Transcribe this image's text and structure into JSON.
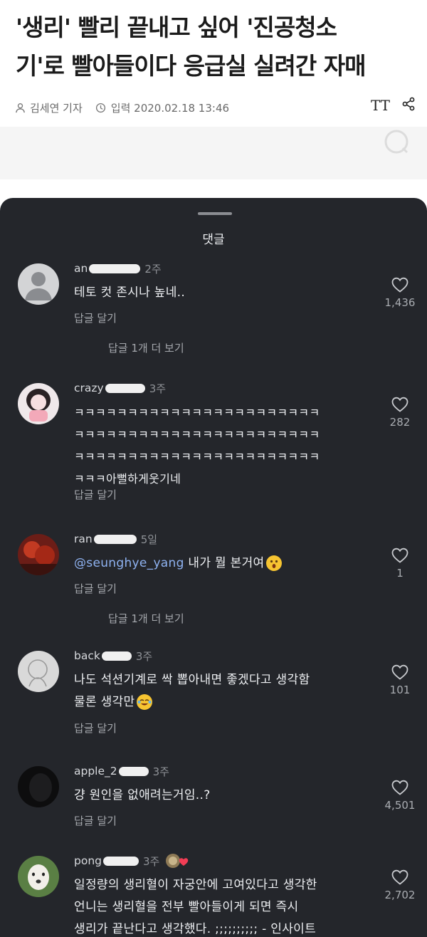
{
  "article": {
    "headline_line1": "'생리' 빨리 끝내고 싶어 '진공청소",
    "headline_line2": "기'로 빨아들이다 응급실 실려간 자매",
    "reporter": "김세연 기자",
    "date_label": "입력 2020.02.18 13:46",
    "font_tool_label": "TT",
    "icons": [
      "person-icon",
      "clock-icon",
      "font-size-icon",
      "share-icon"
    ]
  },
  "sheet": {
    "title": "댓글"
  },
  "comments": [
    {
      "user": "an",
      "ago": "2주",
      "lines": [
        "테토 컷 존시나 높네.."
      ],
      "reply": "답글 달기",
      "likes": "1,436",
      "more": "답글 1개 더 보기"
    },
    {
      "user": "crazy",
      "ago": "3주",
      "lines": [
        "ㅋㅋㅋㅋㅋㅋㅋㅋㅋㅋㅋㅋㅋㅋㅋㅋㅋㅋㅋㅋㅋㅋㅋ",
        "ㅋㅋㅋㅋㅋㅋㅋㅋㅋㅋㅋㅋㅋㅋㅋㅋㅋㅋㅋㅋㅋㅋㅋ",
        "ㅋㅋㅋㅋㅋㅋㅋㅋㅋㅋㅋㅋㅋㅋㅋㅋㅋㅋㅋㅋㅋㅋㅋ",
        "ㅋㅋㅋ아뻘하게웃기네"
      ],
      "reply": "답글 달기",
      "likes": "282"
    },
    {
      "user": "ran",
      "ago": "5일",
      "mention": "@seunghye_yang",
      "text": " 내가 뭘 본거여",
      "reply": "답글 달기",
      "likes": "1",
      "more": "답글 1개 더 보기"
    },
    {
      "user": "back",
      "ago": "3주",
      "lines": [
        "나도 석션기계로 싹 뽑아내면 좋겠다고 생각함",
        "물론 생각만"
      ],
      "reply": "답글 달기",
      "likes": "101"
    },
    {
      "user": "apple_2",
      "ago": "3주",
      "lines": [
        "걍 원인을 없애려는거임..?"
      ],
      "reply": "답글 달기",
      "likes": "4,501"
    },
    {
      "user": "pong",
      "ago": "3주",
      "lines": [
        "일정량의 생리혈이 자궁안에 고여있다고 생각한",
        "언니는 생리혈을 전부 빨아들이게 되면 즉시",
        "생리가 끝난다고 생각했다. ;;;;;;;;;; - 인사이트"
      ],
      "likes": "2,702"
    }
  ]
}
